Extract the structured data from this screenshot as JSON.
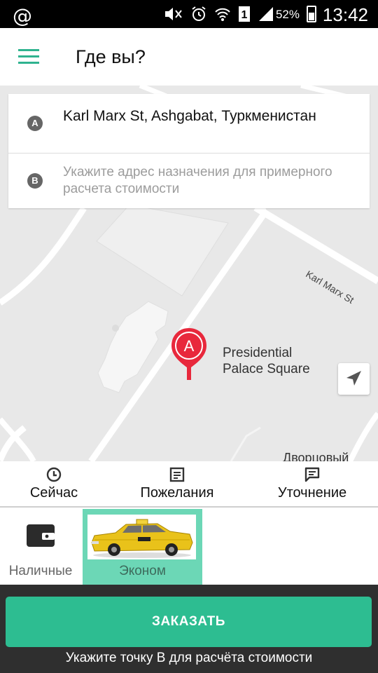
{
  "status_bar": {
    "notification_icon": "at-icon",
    "battery": "52%",
    "time": "13:42"
  },
  "app_bar": {
    "title": "Где вы?"
  },
  "address": {
    "from": {
      "badge": "A",
      "text": "Karl Marx St, Ashgabat, Туркменистан"
    },
    "to": {
      "badge": "B",
      "placeholder": "Укажите адрес назначения для примерного расчета стоимости"
    }
  },
  "map": {
    "pin_label": "A",
    "poi_label": "Presidential Palace Square",
    "street_label": "Karl Marx St",
    "district_label": "Дворцовый"
  },
  "options": [
    {
      "label": "Сейчас",
      "icon": "clock-icon"
    },
    {
      "label": "Пожелания",
      "icon": "list-icon"
    },
    {
      "label": "Уточнение",
      "icon": "comment-icon"
    }
  ],
  "payment": {
    "label": "Наличные",
    "icon": "wallet-icon"
  },
  "tariff": {
    "label": "Эконом",
    "selected": true
  },
  "order": {
    "button_label": "ЗАКАЗАТЬ",
    "hint": "Укажите точку В для расчёта стоимости"
  },
  "colors": {
    "accent": "#2dbd91",
    "selected_tariff": "#6cd7b6",
    "pin": "#e8283c"
  }
}
